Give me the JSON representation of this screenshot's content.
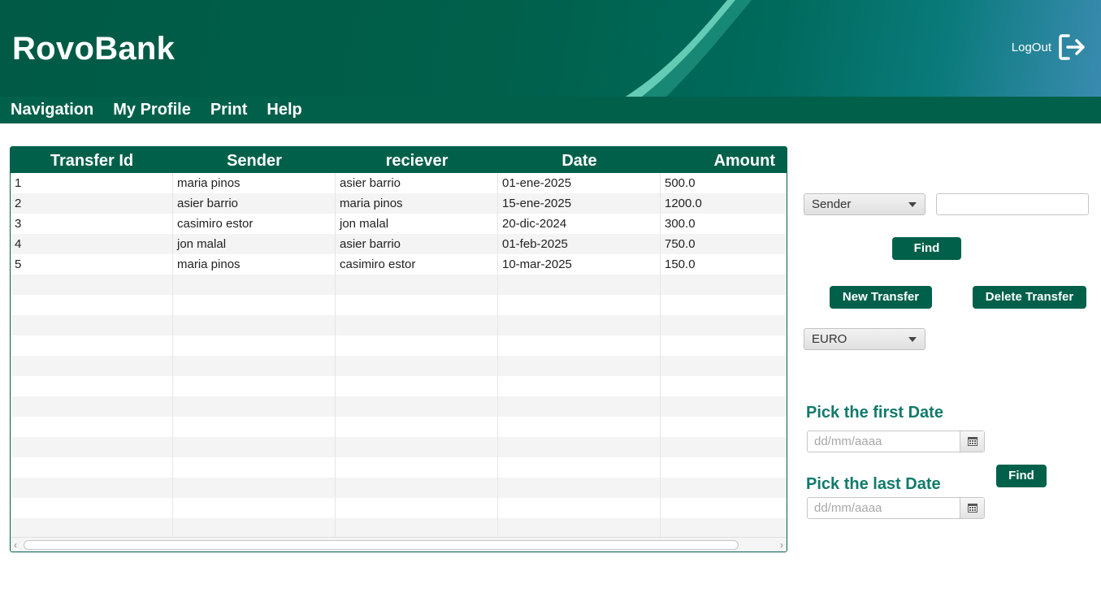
{
  "header": {
    "brand": "RovoBank",
    "logout_label": "LogOut",
    "logout_icon": "logout-icon",
    "accent_color": "#00604a"
  },
  "menu": {
    "items": [
      "Navigation",
      "My Profile",
      "Print",
      "Help"
    ]
  },
  "table": {
    "columns": [
      "Transfer Id",
      "Sender",
      "reciever",
      "Date",
      "Amount"
    ],
    "rows": [
      [
        "1",
        "maria pinos",
        "asier barrio",
        "01-ene-2025",
        "500.0"
      ],
      [
        "2",
        "asier barrio",
        "maria pinos",
        "15-ene-2025",
        "1200.0"
      ],
      [
        "3",
        "casimiro estor",
        "jon malal",
        "20-dic-2024",
        "300.0"
      ],
      [
        "4",
        "jon malal",
        "asier barrio",
        "01-feb-2025",
        "750.0"
      ],
      [
        "5",
        "maria pinos",
        "casimiro estor",
        "10-mar-2025",
        "150.0"
      ]
    ]
  },
  "filter": {
    "field_selected": "Sender",
    "search_value": "",
    "find_label": "Find"
  },
  "actions": {
    "new_transfer": "New Transfer",
    "delete_transfer": "Delete Transfer"
  },
  "currency": {
    "selected": "EURO"
  },
  "date_filter": {
    "first_label": "Pick the first Date",
    "last_label": "Pick the last Date",
    "placeholder": "dd/mm/aaaa",
    "find_label": "Find",
    "calendar_icon": "calendar-icon"
  }
}
